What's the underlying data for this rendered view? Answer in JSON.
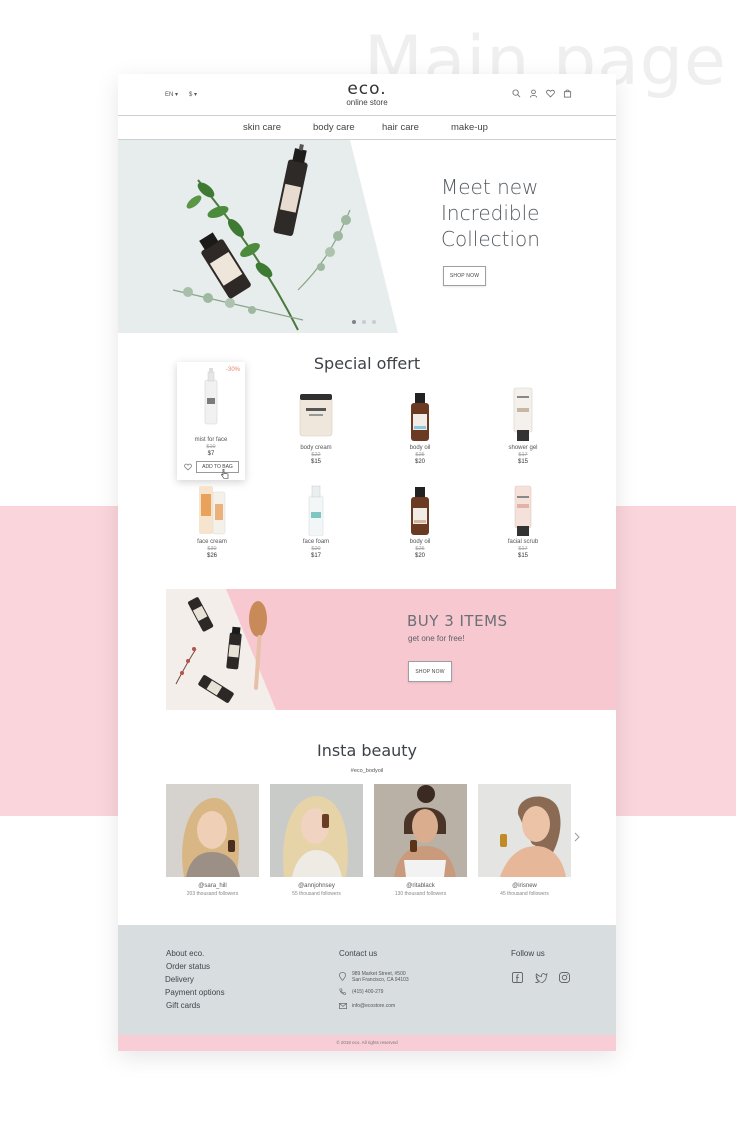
{
  "background_title": "Main page",
  "header": {
    "language": "EN",
    "currency": "$",
    "logo": "eco.",
    "logo_sub": "online store"
  },
  "nav": [
    "skin care",
    "body care",
    "hair care",
    "make-up"
  ],
  "hero": {
    "title_lines": [
      "Meet new",
      "Incredible",
      "Collection"
    ],
    "button": "SHOP NOW",
    "slides": 3,
    "active_slide": 1
  },
  "special": {
    "title": "Special offert",
    "featured_discount": "-30%",
    "add_to_bag": "ADD TO BAG",
    "products": [
      {
        "name": "mist for face",
        "old": "$10",
        "new": "$7"
      },
      {
        "name": "body cream",
        "old": "$22",
        "new": "$15"
      },
      {
        "name": "body oil",
        "old": "$25",
        "new": "$20"
      },
      {
        "name": "shower gel",
        "old": "$17",
        "new": "$15"
      },
      {
        "name": "face cream",
        "old": "$30",
        "new": "$26"
      },
      {
        "name": "face foam",
        "old": "$20",
        "new": "$17"
      },
      {
        "name": "body oil",
        "old": "$25",
        "new": "$20"
      },
      {
        "name": "facial scrub",
        "old": "$17",
        "new": "$15"
      }
    ]
  },
  "promo": {
    "title": "BUY 3 ITEMS",
    "subtitle": "get one for free!",
    "button": "SHOP NOW"
  },
  "insta": {
    "title": "Insta beauty",
    "hashtag": "#eco_bodyoil",
    "posts": [
      {
        "handle": "@sara_hill",
        "followers": "203 thousand followers"
      },
      {
        "handle": "@annjohnsey",
        "followers": "55 thousand followers"
      },
      {
        "handle": "@ritablack",
        "followers": "130 thousand followers"
      },
      {
        "handle": "@irisnew",
        "followers": "45 thousand followers"
      }
    ]
  },
  "footer": {
    "links": [
      "About eco.",
      "Order status",
      "Delivery",
      "Payment options",
      "Gift cards"
    ],
    "contact_title": "Contact us",
    "address": [
      "989 Market Street, #500",
      "San Francisco, CA 94103"
    ],
    "phone": "(415) 400-279",
    "email": "info@ecostore.com",
    "follow_title": "Follow us",
    "copyright": "© 2018 eco. All rights reserved"
  },
  "colors": {
    "pink": "#fbd5dc",
    "footer": "#d8dde0",
    "accent_discount": "#e1886c"
  }
}
